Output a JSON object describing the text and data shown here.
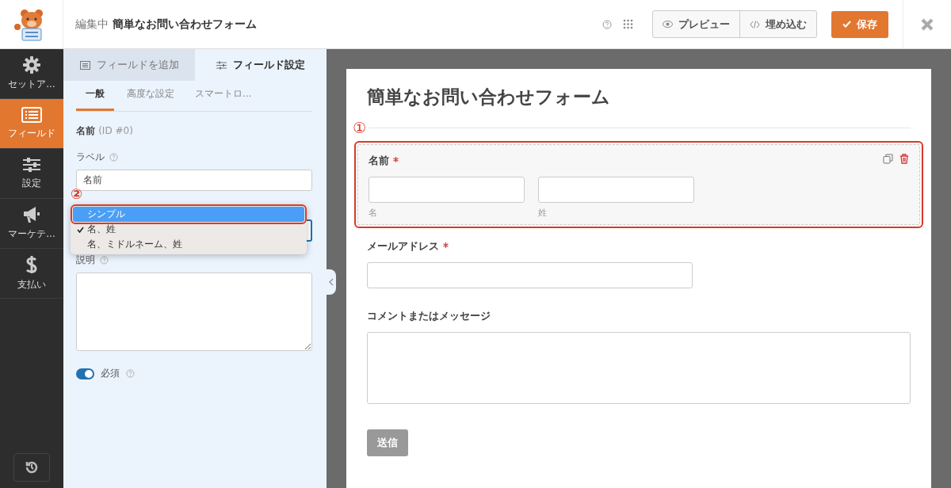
{
  "header": {
    "editing_label": "編集中",
    "form_name": "簡単なお問い合わせフォーム",
    "buttons": [
      {
        "kind": "preview",
        "label": "プレビュー"
      },
      {
        "kind": "embed",
        "label": "埋め込む"
      }
    ],
    "save": "保存"
  },
  "sidebar": {
    "items": [
      {
        "kind": "gear",
        "label": "セットア...",
        "selected": false
      },
      {
        "kind": "fields",
        "label": "フィールド",
        "selected": true
      },
      {
        "kind": "sliders",
        "label": "設定",
        "selected": false
      },
      {
        "kind": "megaphone",
        "label": "マーケテ...",
        "selected": false
      },
      {
        "kind": "dollar",
        "label": "支払い",
        "selected": false
      }
    ]
  },
  "panel": {
    "tabs": [
      {
        "kind": "list",
        "label": "フィールドを追加",
        "selected": false
      },
      {
        "kind": "sliders",
        "label": "フィールド設定",
        "selected": true
      }
    ],
    "subtabs": [
      {
        "label": "一般",
        "selected": true
      },
      {
        "label": "高度な設定",
        "selected": false
      },
      {
        "label": "スマートロ...",
        "selected": false
      }
    ],
    "field_title": "名前",
    "field_id": "(ID #0)",
    "label_field": {
      "label": "ラベル",
      "value": "名前"
    },
    "format_options": [
      {
        "label": "シンプル",
        "selected": true,
        "checked": false
      },
      {
        "label": "名、姓",
        "selected": false,
        "checked": true
      },
      {
        "label": "名、ミドルネーム、姓",
        "selected": false,
        "checked": false
      }
    ],
    "description": {
      "label": "説明"
    },
    "required": {
      "label": "必須",
      "on": true
    }
  },
  "annotations": [
    "①",
    "②"
  ],
  "form": {
    "title": "簡単なお問い合わせフォーム",
    "fields": [
      {
        "kind": "name",
        "label": "名前",
        "required": true,
        "selected": true,
        "sublabels": [
          "名",
          "姓"
        ]
      },
      {
        "kind": "email",
        "label": "メールアドレス",
        "required": true,
        "selected": false
      },
      {
        "kind": "textarea",
        "label": "コメントまたはメッセージ",
        "required": false,
        "selected": false
      }
    ],
    "submit": "送信"
  }
}
